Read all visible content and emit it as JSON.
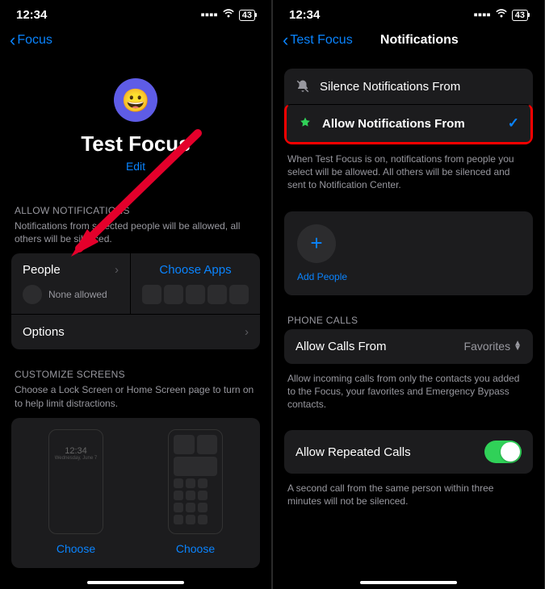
{
  "status": {
    "time": "12:34",
    "battery": "43"
  },
  "left": {
    "back": "Focus",
    "title": "Test Focus",
    "edit": "Edit",
    "allow_hdr": "ALLOW NOTIFICATIONS",
    "allow_sub": "Notifications from selected people will be allowed, all others will be silenced.",
    "people": "People",
    "none": "None allowed",
    "choose_apps": "Choose Apps",
    "options": "Options",
    "cust_hdr": "CUSTOMIZE SCREENS",
    "cust_sub": "Choose a Lock Screen or Home Screen page to turn on to help limit distractions.",
    "lock_time": "12:34",
    "lock_date": "Wednesday, June 7",
    "choose": "Choose"
  },
  "right": {
    "back": "Test Focus",
    "title": "Notifications",
    "silence": "Silence Notifications From",
    "allow": "Allow Notifications From",
    "allow_desc": "When Test Focus is on, notifications from people you select will be allowed. All others will be silenced and sent to Notification Center.",
    "add_people": "Add People",
    "phone_hdr": "PHONE CALLS",
    "calls_from": "Allow Calls From",
    "favorites": "Favorites",
    "calls_desc": "Allow incoming calls from only the contacts you added to the Focus, your favorites and Emergency Bypass contacts.",
    "repeated": "Allow Repeated Calls",
    "repeated_desc": "A second call from the same person within three minutes will not be silenced."
  }
}
